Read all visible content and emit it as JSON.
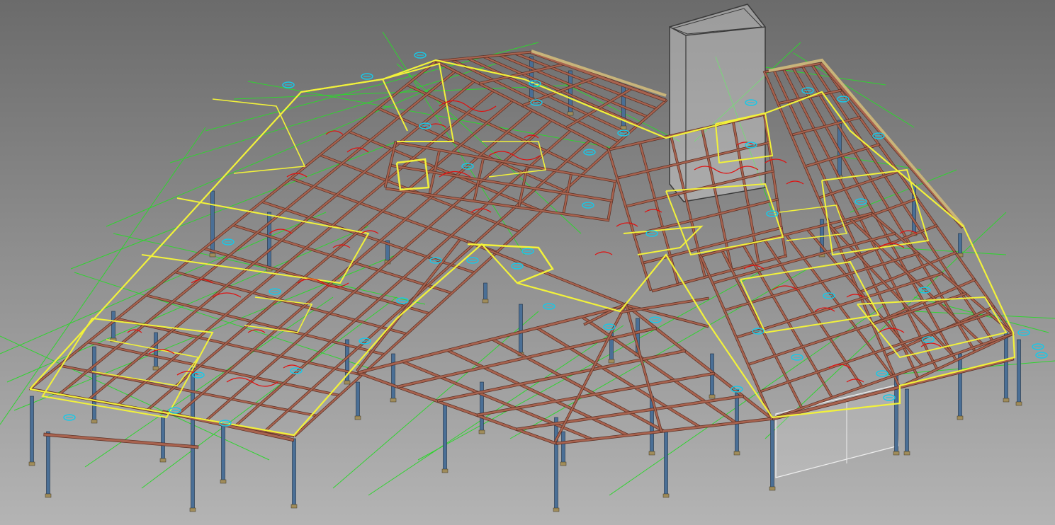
{
  "view": {
    "background_top": "#6b6b6b",
    "background_bottom": "#b4b4b4"
  },
  "colors": {
    "beam": "#a8634f",
    "beam_stroke": "#5a2f24",
    "column": "#4a6f96",
    "column_stroke": "#1f2f44",
    "base_plate": "#a08c5a",
    "gridline": "#2fd42f",
    "outline": "#f2f23a",
    "annotation": "#e01010",
    "grid_tag": "#18c8e8",
    "core_wall": "#d8d8d8",
    "core_edge": "#3a3a3a",
    "roof_edge": "#c8b47a"
  },
  "legend_elements": {
    "beam": "steel-beam",
    "column": "steel-column",
    "gridline": "structural-gridline",
    "outline": "selected-framing-outline",
    "annotation": "connection-annotation",
    "grid_tag": "gridline-tag",
    "core": "stair-elevator-core"
  }
}
